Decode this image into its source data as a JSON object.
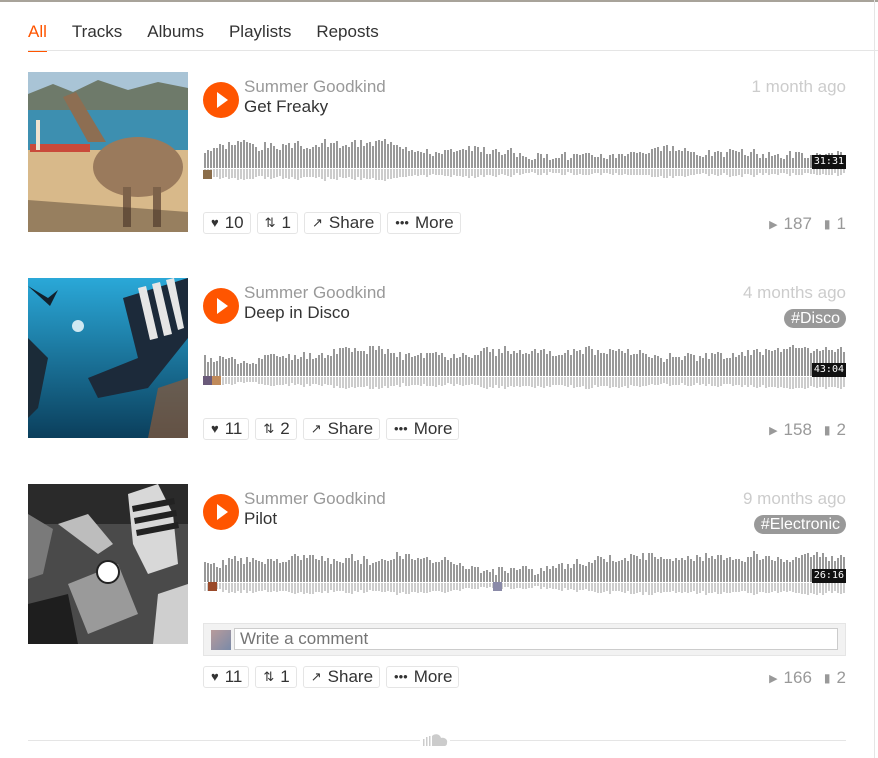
{
  "tabs": [
    {
      "label": "All",
      "active": true
    },
    {
      "label": "Tracks",
      "active": false
    },
    {
      "label": "Albums",
      "active": false
    },
    {
      "label": "Playlists",
      "active": false
    },
    {
      "label": "Reposts",
      "active": false
    }
  ],
  "colors": {
    "accent": "#ff5500",
    "muted": "#999999",
    "wave": "#999999"
  },
  "icons": {
    "play": "play-icon",
    "like": "heart-icon",
    "repost": "repost-icon",
    "share": "share-icon",
    "more": "more-icon",
    "plays": "play-count-icon",
    "comments": "comment-icon",
    "footer": "soundcloud-logo-icon"
  },
  "tracks": [
    {
      "artist": "Summer Goodkind",
      "title": "Get Freaky",
      "posted": "1 month ago",
      "tag": "",
      "duration": "31:31",
      "likes": "10",
      "reposts": "1",
      "share_label": "Share",
      "more_label": "More",
      "plays": "187",
      "comments": "1"
    },
    {
      "artist": "Summer Goodkind",
      "title": "Deep in Disco",
      "posted": "4 months ago",
      "tag": "#Disco",
      "duration": "43:04",
      "likes": "11",
      "reposts": "2",
      "share_label": "Share",
      "more_label": "More",
      "plays": "158",
      "comments": "2"
    },
    {
      "artist": "Summer Goodkind",
      "title": "Pilot",
      "posted": "9 months ago",
      "tag": "#Electronic",
      "duration": "26:16",
      "likes": "11",
      "reposts": "1",
      "share_label": "Share",
      "more_label": "More",
      "plays": "166",
      "comments": "2",
      "comment_placeholder": "Write a comment"
    }
  ]
}
